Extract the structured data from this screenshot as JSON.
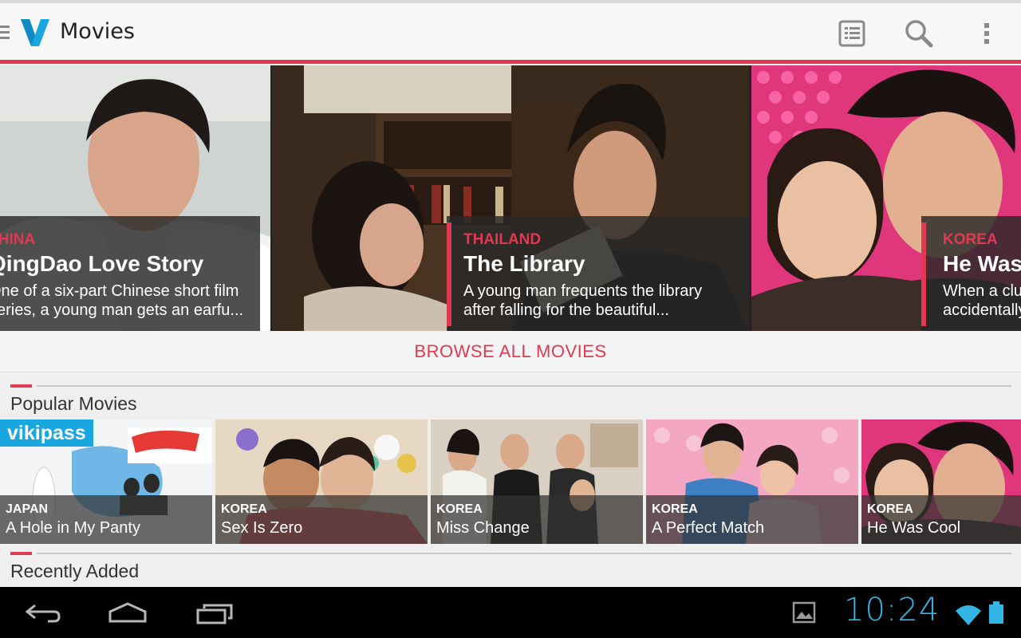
{
  "app": {
    "title": "Movies",
    "logo": "V",
    "icons": {
      "menu": "hamburger-icon",
      "list": "list-view-icon",
      "search": "search-icon",
      "overflow": "overflow-menu-icon"
    },
    "accent": "#e03a52"
  },
  "featured": [
    {
      "country": "CHINA",
      "title": "QingDao Love Story",
      "desc_line1": "One of a six-part Chinese short film",
      "desc_line2": "series, a young man gets an earfu..."
    },
    {
      "country": "THAILAND",
      "title": "The Library",
      "desc_line1": "A young man frequents the library",
      "desc_line2": "after falling for the beautiful..."
    },
    {
      "country": "KOREA",
      "title": "He Was Cool",
      "desc_line1": "When a clumsy girl",
      "desc_line2": "accidentally..."
    }
  ],
  "browse_label": "BROWSE ALL MOVIES",
  "popular": {
    "heading": "Popular Movies",
    "items": [
      {
        "country": "JAPAN",
        "title": "A Hole in My Panty",
        "badge": "vikipass"
      },
      {
        "country": "KOREA",
        "title": "Sex Is Zero"
      },
      {
        "country": "KOREA",
        "title": "Miss Change"
      },
      {
        "country": "KOREA",
        "title": "A Perfect Match"
      },
      {
        "country": "KOREA",
        "title": "He Was Cool"
      }
    ]
  },
  "recent": {
    "heading": "Recently Added"
  },
  "system": {
    "clock": "10:24",
    "clock_color": "#33b5e5",
    "icons": {
      "back": "back-icon",
      "home": "home-icon",
      "recents": "recent-apps-icon",
      "gallery": "gallery-notification-icon",
      "wifi": "wifi-icon",
      "battery": "battery-icon"
    }
  }
}
